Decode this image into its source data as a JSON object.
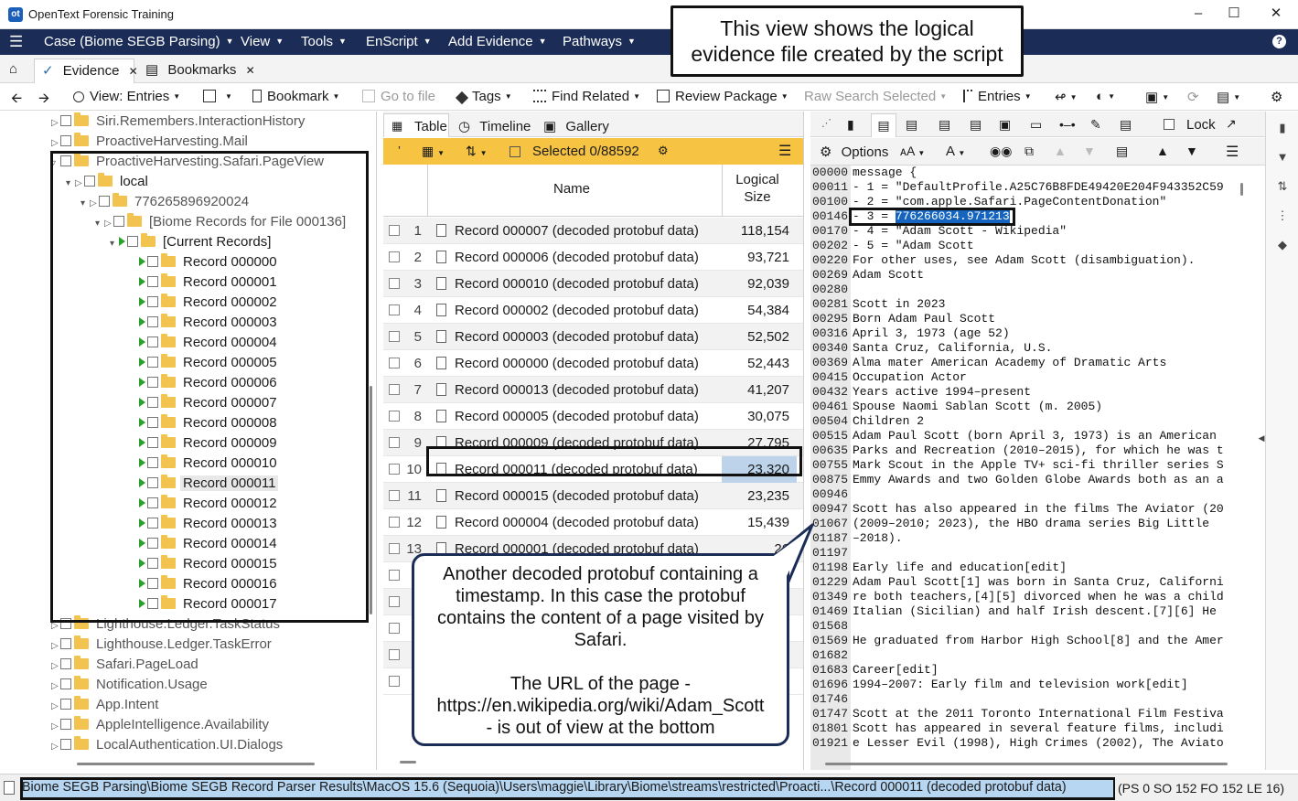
{
  "window": {
    "title": "OpenText Forensic Training"
  },
  "menu": [
    {
      "label": "Case (Biome SEGB Parsing)"
    },
    {
      "label": "View"
    },
    {
      "label": "Tools"
    },
    {
      "label": "EnScript"
    },
    {
      "label": "Add Evidence"
    },
    {
      "label": "Pathways"
    }
  ],
  "tabs": [
    {
      "label": "Evidence"
    },
    {
      "label": "Bookmarks"
    }
  ],
  "toolbar": {
    "view": "View: Entries",
    "bookmark": "Bookmark",
    "goto_file": "Go to file",
    "tags": "Tags",
    "find_related": "Find Related",
    "review_package": "Review Package",
    "raw_search": "Raw Search Selected",
    "entries": "Entries"
  },
  "tree": {
    "top_items": [
      "Siri.Remembers.InteractionHistory",
      "ProactiveHarvesting.Mail",
      "ProactiveHarvesting.Safari.PageView"
    ],
    "local": "local",
    "device_id": "776265896920024",
    "records_folder": "[Biome Records for File 000136]",
    "current_records": "[Current Records]",
    "records": [
      "Record 000000",
      "Record 000001",
      "Record 000002",
      "Record 000003",
      "Record 000004",
      "Record 000005",
      "Record 000006",
      "Record 000007",
      "Record 000008",
      "Record 000009",
      "Record 000010",
      "Record 000011",
      "Record 000012",
      "Record 000013",
      "Record 000014",
      "Record 000015",
      "Record 000016",
      "Record 000017"
    ],
    "selected_record": "Record 000011",
    "bottom_items": [
      "Lighthouse.Ledger.TaskStatus",
      "Lighthouse.Ledger.TaskError",
      "Safari.PageLoad",
      "Notification.Usage",
      "App.Intent",
      "AppleIntelligence.Availability",
      "LocalAuthentication.UI.Dialogs"
    ]
  },
  "table": {
    "tabs": [
      "Table",
      "Timeline",
      "Gallery"
    ],
    "selected": "Selected 0/88592",
    "col_name": "Name",
    "col_size_line1": "Logical",
    "col_size_line2": "Size",
    "rows": [
      {
        "n": "1",
        "name": "Record 000007 (decoded protobuf data)",
        "size": "118,154"
      },
      {
        "n": "2",
        "name": "Record 000006 (decoded protobuf data)",
        "size": "93,721"
      },
      {
        "n": "3",
        "name": "Record 000010 (decoded protobuf data)",
        "size": "92,039"
      },
      {
        "n": "4",
        "name": "Record 000002 (decoded protobuf data)",
        "size": "54,384"
      },
      {
        "n": "5",
        "name": "Record 000003 (decoded protobuf data)",
        "size": "52,502"
      },
      {
        "n": "6",
        "name": "Record 000000 (decoded protobuf data)",
        "size": "52,443"
      },
      {
        "n": "7",
        "name": "Record 000013 (decoded protobuf data)",
        "size": "41,207"
      },
      {
        "n": "8",
        "name": "Record 000005 (decoded protobuf data)",
        "size": "30,075"
      },
      {
        "n": "9",
        "name": "Record 000009 (decoded protobuf data)",
        "size": "27,795"
      },
      {
        "n": "10",
        "name": "Record 000011 (decoded protobuf data)",
        "size": "23,320"
      },
      {
        "n": "11",
        "name": "Record 000015 (decoded protobuf data)",
        "size": "23,235"
      },
      {
        "n": "12",
        "name": "Record 000004 (decoded protobuf data)",
        "size": "15,439"
      },
      {
        "n": "13",
        "name": "Record 000001 (decoded protobuf data)",
        "size": "26"
      },
      {
        "n": "1",
        "name": "",
        "size": ""
      },
      {
        "n": "1",
        "name": "",
        "size": ""
      },
      {
        "n": "1",
        "name": "",
        "size": ""
      },
      {
        "n": "1",
        "name": "",
        "size": ""
      },
      {
        "n": "1",
        "name": "",
        "size": ""
      }
    ]
  },
  "viewer": {
    "options": "Options",
    "lock": "Lock",
    "lines": [
      {
        "off": "00000",
        "text": "message {"
      },
      {
        "off": "00011",
        "text": "- 1 = \"DefaultProfile.A25C76B8FDE49420E204F943352C59"
      },
      {
        "off": "00100",
        "text": "- 2 = \"com.apple.Safari.PageContentDonation\""
      },
      {
        "off": "00146",
        "text": "- 3 = ",
        "hl": "776266034.971213"
      },
      {
        "off": "00170",
        "text": "- 4 = \"Adam Scott - Wikipedia\""
      },
      {
        "off": "00202",
        "text": "- 5 = \"Adam Scott"
      },
      {
        "off": "00220",
        "text": "For other uses, see Adam Scott (disambiguation)."
      },
      {
        "off": "00269",
        "text": "Adam Scott"
      },
      {
        "off": "00280",
        "text": ""
      },
      {
        "off": "00281",
        "text": "Scott in 2023"
      },
      {
        "off": "00295",
        "text": "Born Adam Paul Scott"
      },
      {
        "off": "00316",
        "text": "April 3, 1973 (age 52)"
      },
      {
        "off": "00340",
        "text": "Santa Cruz, California, U.S."
      },
      {
        "off": "00369",
        "text": "Alma mater American Academy of Dramatic Arts"
      },
      {
        "off": "00415",
        "text": "Occupation Actor"
      },
      {
        "off": "00432",
        "text": "Years active 1994–present"
      },
      {
        "off": "00461",
        "text": "Spouse Naomi Sablan Scott  (m. 2005)"
      },
      {
        "off": "00504",
        "text": "Children 2"
      },
      {
        "off": "00515",
        "text": "Adam Paul Scott (born April 3, 1973) is an American"
      },
      {
        "off": "00635",
        "text": "Parks and Recreation (2010–2015), for which he was t"
      },
      {
        "off": "00755",
        "text": "Mark Scout in the Apple TV+ sci-fi thriller series S"
      },
      {
        "off": "00875",
        "text": "Emmy Awards and two Golden Globe Awards both as an a"
      },
      {
        "off": "00946",
        "text": ""
      },
      {
        "off": "00947",
        "text": "Scott has also appeared in the films The Aviator (20"
      },
      {
        "off": "01067",
        "text": " (2009–2010; 2023), the HBO drama series Big Little"
      },
      {
        "off": "01187",
        "text": "–2018)."
      },
      {
        "off": "01197",
        "text": ""
      },
      {
        "off": "01198",
        "text": "Early life and education[edit]"
      },
      {
        "off": "01229",
        "text": "Adam Paul Scott[1] was born in Santa Cruz, Californi"
      },
      {
        "off": "01349",
        "text": "re both teachers,[4][5] divorced when he was a child"
      },
      {
        "off": "01469",
        "text": " Italian (Sicilian) and half Irish descent.[7][6] He"
      },
      {
        "off": "01568",
        "text": ""
      },
      {
        "off": "01569",
        "text": "He graduated from Harbor High School[8] and the Amer"
      },
      {
        "off": "01682",
        "text": ""
      },
      {
        "off": "01683",
        "text": "Career[edit]"
      },
      {
        "off": "01696",
        "text": "1994–2007: Early film and television work[edit]"
      },
      {
        "off": "01746",
        "text": ""
      },
      {
        "off": "01747",
        "text": "Scott at the 2011 Toronto International Film Festiva"
      },
      {
        "off": "01801",
        "text": "Scott has appeared in several feature films, includi"
      },
      {
        "off": "01921",
        "text": "e Lesser Evil (1998), High Crimes (2002), The Aviato"
      }
    ]
  },
  "status": {
    "path": "Biome SEGB Parsing\\Biome SEGB Record Parser Results\\MacOS 15.6 (Sequoia)\\Users\\maggie\\Library\\Biome\\streams\\restricted\\Proacti...\\Record 000011 (decoded protobuf data)",
    "pos": "(PS 0 SO 152 FO 152 LE 16)"
  },
  "callouts": {
    "top_line1": "This view shows the logical",
    "top_line2": "evidence file created by the script",
    "bottom_line1": "Another decoded protobuf containing a",
    "bottom_line2": "timestamp. In this case the protobuf",
    "bottom_line3": "contains the content of a page visited by",
    "bottom_line4": "Safari.",
    "bottom_line5": "The URL of the page -",
    "bottom_line6": "https://en.wikipedia.org/wiki/Adam_Scott",
    "bottom_line7": "- is out of view at the bottom"
  },
  "colors": {
    "menubar": "#1b2d57",
    "highlight": "#f6c343",
    "selection": "#1565c0"
  }
}
